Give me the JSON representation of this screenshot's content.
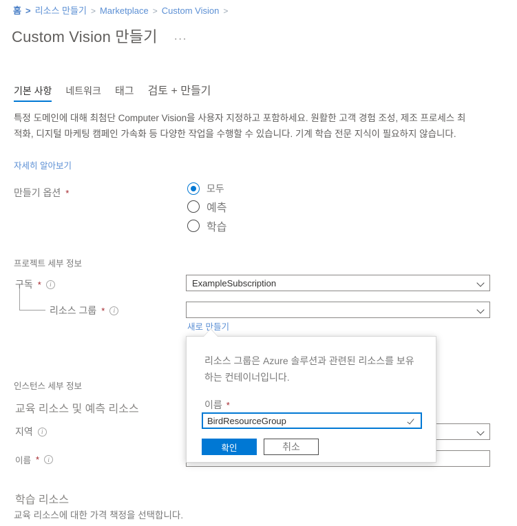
{
  "breadcrumb": {
    "items": [
      "홈",
      "리소스 만들기",
      "Marketplace",
      "Custom Vision"
    ],
    "separator": ">"
  },
  "header": {
    "title": "Custom Vision 만들기",
    "more_menu": "···"
  },
  "tabs": [
    {
      "label": "기본 사항",
      "active": true
    },
    {
      "label": "네트워크",
      "active": false
    },
    {
      "label": "태그",
      "active": false
    },
    {
      "label": "검토 + 만들기",
      "active": false
    }
  ],
  "description": {
    "text": "특정 도메인에 대해 최첨단 Computer Vision을 사용자 지정하고 포함하세요. 원활한 고객 경험 조성, 제조 프로세스 최적화, 디지털 마케팅 캠페인 가속화 등 다양한 작업을 수행할 수 있습니다. 기계 학습 전문 지식이 필요하지 않습니다.",
    "learn_more": "자세히 알아보기"
  },
  "create_options": {
    "label": "만들기 옵션",
    "required_mark": "*",
    "options": [
      {
        "label": "모두",
        "selected": true
      },
      {
        "label": "예측",
        "selected": false
      },
      {
        "label": "학습",
        "selected": false
      }
    ]
  },
  "project_details": {
    "heading": "프로젝트 세부 정보",
    "subscription": {
      "label": "구독",
      "required_mark": "*",
      "value": "ExampleSubscription"
    },
    "resource_group": {
      "label": "리소스 그룹",
      "required_mark": "*",
      "value": "",
      "create_new": "새로 만들기"
    }
  },
  "resource_group_callout": {
    "description": "리소스 그룹은 Azure 솔루션과 관련된 리소스를 보유하는 컨테이너입니다.",
    "name_label": "이름",
    "required_mark": "*",
    "name_value": "BirdResourceGroup",
    "ok_button": "확인",
    "cancel_button": "취소"
  },
  "instance_details": {
    "heading": "인스턴스 세부 정보",
    "resources_label": "교육 리소스 및 예측 리소스",
    "region": {
      "label": "지역",
      "value": ""
    },
    "name": {
      "label": "이름",
      "required_mark": "*",
      "value": ""
    }
  },
  "training_resource": {
    "title": "학습 리소스",
    "description": "교육 리소스에 대한 가격 책정을 선택합니다."
  },
  "colors": {
    "accent": "#0078d4",
    "link": "#5b8fd4",
    "required": "#a4262c",
    "text": "#605e5c"
  }
}
